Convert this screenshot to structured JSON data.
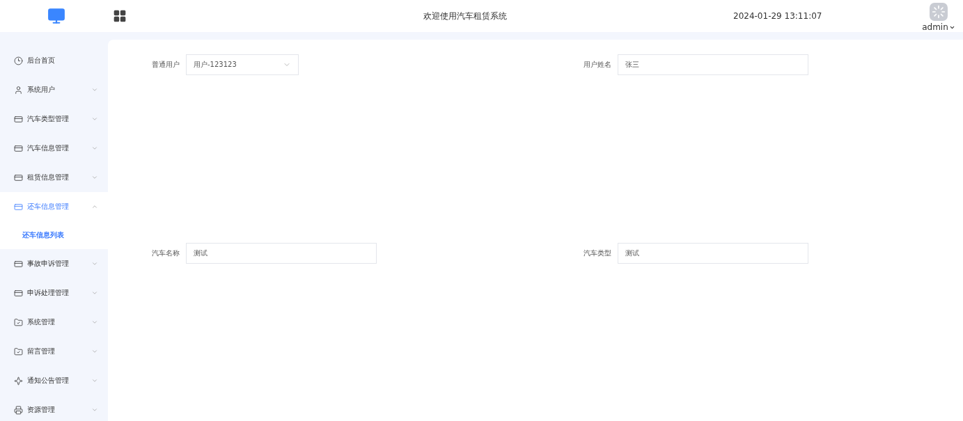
{
  "header": {
    "title": "欢迎使用汽车租赁系统",
    "datetime": "2024-01-29 13:11:07",
    "user": "admin"
  },
  "sidebar": {
    "items": [
      {
        "label": "后台首页",
        "expandable": false,
        "expanded": false
      },
      {
        "label": "系统用户",
        "expandable": true,
        "expanded": false
      },
      {
        "label": "汽车类型管理",
        "expandable": true,
        "expanded": false
      },
      {
        "label": "汽车信息管理",
        "expandable": true,
        "expanded": false
      },
      {
        "label": "租赁信息管理",
        "expandable": true,
        "expanded": false
      },
      {
        "label": "还车信息管理",
        "expandable": true,
        "expanded": true,
        "children": [
          {
            "label": "还车信息列表",
            "selected": true
          }
        ]
      },
      {
        "label": "事故申诉管理",
        "expandable": true,
        "expanded": false
      },
      {
        "label": "申诉处理管理",
        "expandable": true,
        "expanded": false
      },
      {
        "label": "系统管理",
        "expandable": true,
        "expanded": false
      },
      {
        "label": "留言管理",
        "expandable": true,
        "expanded": false
      },
      {
        "label": "通知公告管理",
        "expandable": true,
        "expanded": false
      },
      {
        "label": "资源管理",
        "expandable": true,
        "expanded": false
      }
    ]
  },
  "form": {
    "rows": [
      [
        {
          "label": "普通用户",
          "kind": "select",
          "value": "用户-123123"
        },
        {
          "label": "用户姓名",
          "kind": "input",
          "value": "张三"
        }
      ],
      [
        {
          "label": "汽车名称",
          "kind": "input",
          "value": "测试"
        },
        {
          "label": "汽车类型",
          "kind": "input",
          "value": "测试"
        }
      ]
    ]
  }
}
